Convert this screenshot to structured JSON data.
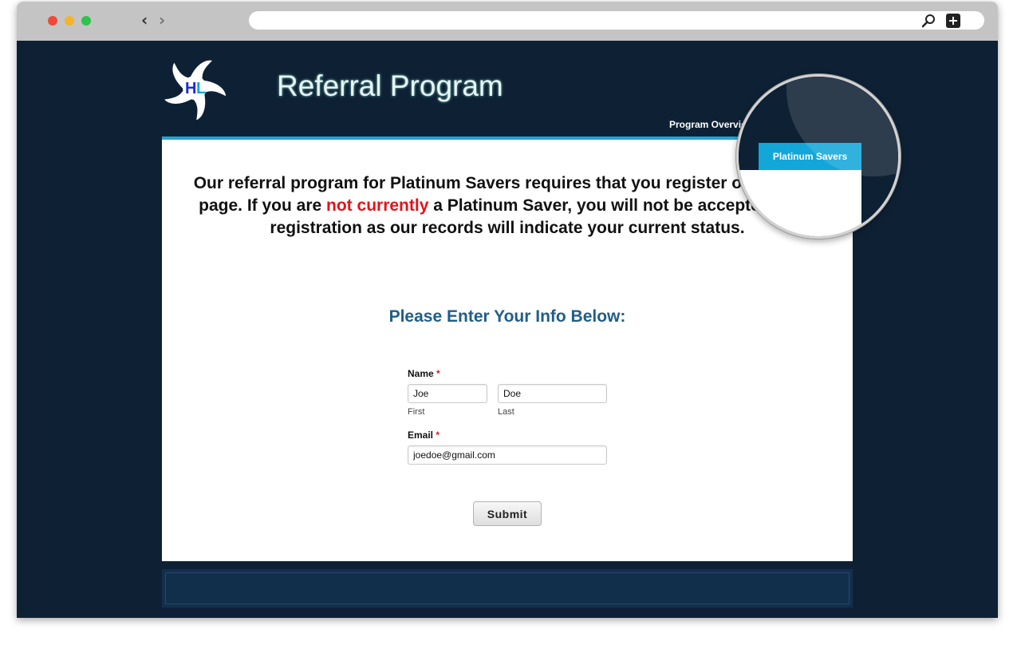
{
  "browser": {
    "url": "",
    "icons": [
      "search-icon",
      "new-tab-plus-icon",
      "back-arrow-icon",
      "forward-arrow-icon"
    ]
  },
  "site": {
    "logo_letters": "HL",
    "title": "Referral Program",
    "nav": {
      "overview": "Program Overview",
      "platinum": "Platinum Savers"
    }
  },
  "intro": {
    "part1": "Our referral program for Platinum Savers requires that you register on the next page. If you are ",
    "highlight": "not currently",
    "part2": " a Platinum Saver, you will not be accepted upon registration as our records will indicate your current status."
  },
  "form": {
    "heading": "Please Enter Your Info Below:",
    "name_label": "Name",
    "required_mark": "*",
    "first_value": "Joe",
    "first_sublabel": "First",
    "last_value": "Doe",
    "last_sublabel": "Last",
    "email_label": "Email",
    "email_value": "joedoe@gmail.com",
    "submit_label": "Submit"
  },
  "colors": {
    "page_bg": "#0e2134",
    "accent": "#12a6d9",
    "heading": "#215e87",
    "highlight": "#e0141a"
  }
}
